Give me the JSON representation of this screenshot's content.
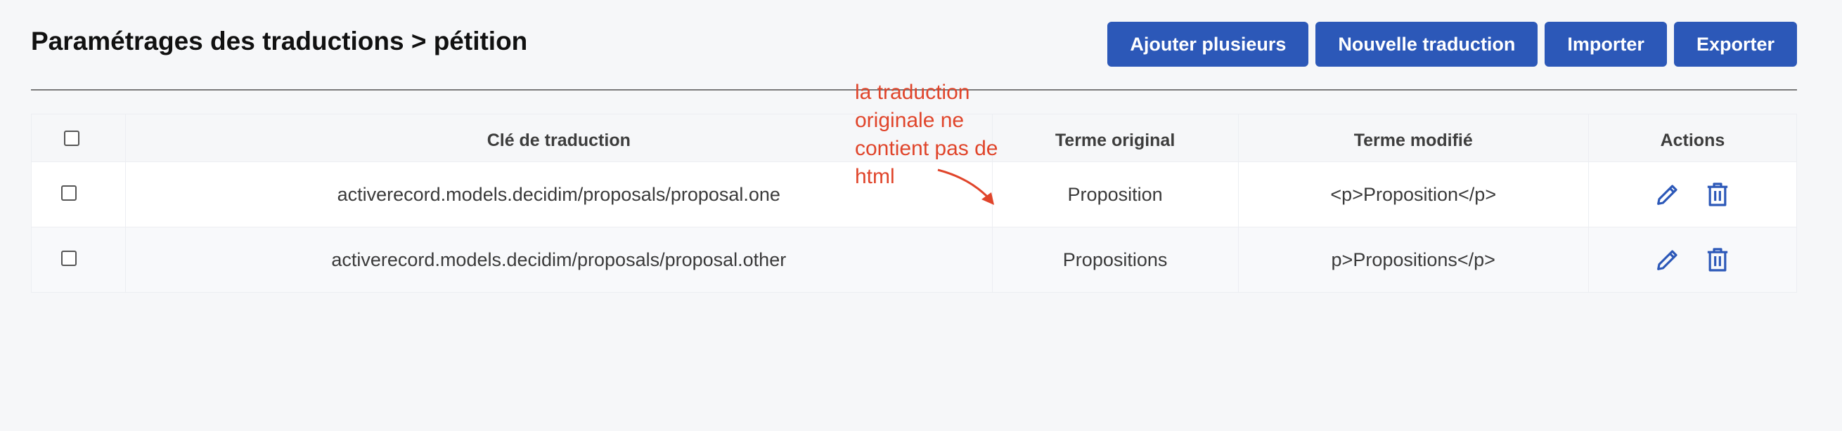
{
  "header": {
    "title": "Paramétrages des traductions > pétition",
    "buttons": {
      "add_multiple": "Ajouter plusieurs",
      "new_translation": "Nouvelle traduction",
      "import": "Importer",
      "export": "Exporter"
    }
  },
  "table": {
    "columns": {
      "key": "Clé de traduction",
      "original": "Terme original",
      "modified": "Terme modifié",
      "actions": "Actions"
    },
    "rows": [
      {
        "key": "activerecord.models.decidim/proposals/proposal.one",
        "original": "Proposition",
        "modified": "<p>Proposition</p>"
      },
      {
        "key": "activerecord.models.decidim/proposals/proposal.other",
        "original": "Propositions",
        "modified": "p>Propositions</p>"
      }
    ]
  },
  "annotation": {
    "lines": [
      "la traduction",
      "originale ne",
      "contient pas de",
      "html"
    ]
  },
  "icons": {
    "edit": "pencil-icon",
    "delete": "trash-icon"
  },
  "colors": {
    "primary_button": "#2c58b8",
    "action_icon": "#2c58b8",
    "annotation": "#e0452b",
    "background": "#f6f7f9"
  }
}
